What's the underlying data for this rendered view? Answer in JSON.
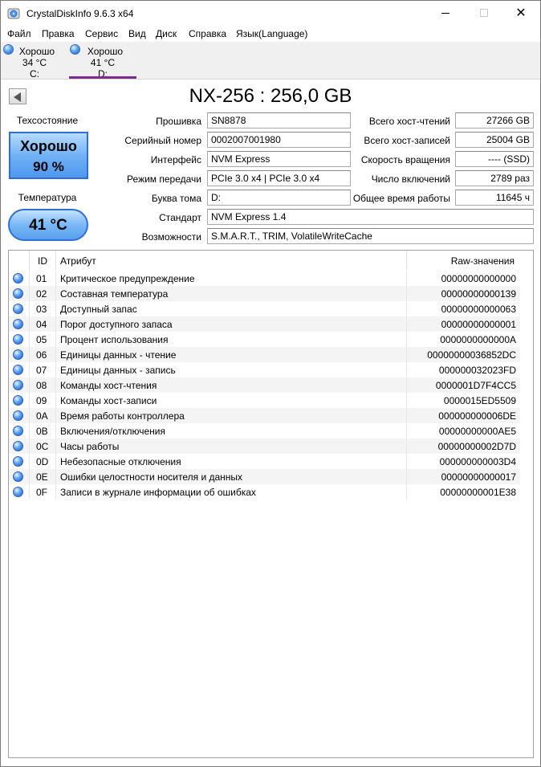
{
  "window": {
    "title": "CrystalDiskInfo 9.6.3 x64",
    "minimize": "–",
    "maximize": "☐",
    "close": "✕"
  },
  "menu": [
    "Файл",
    "Правка",
    "Сервис",
    "Вид",
    "Диск",
    "Справка",
    "Язык(Language)"
  ],
  "disks": [
    {
      "status": "Хорошо",
      "temp": "34 °C",
      "letter": "C:",
      "active": false
    },
    {
      "status": "Хорошо",
      "temp": "41 °C",
      "letter": "D:",
      "active": true
    }
  ],
  "disk": {
    "title": "NX-256 : 256,0 GB",
    "health_label": "Техсостояние",
    "health_status": "Хорошо",
    "health_percent": "90 %",
    "temp_label": "Температура",
    "temperature": "41 °C"
  },
  "info": {
    "firmware_label": "Прошивка",
    "firmware": "SN8878",
    "serial_label": "Серийный номер",
    "serial": "0002007001980",
    "interface_label": "Интерфейс",
    "interface": "NVM Express",
    "transfer_label": "Режим передачи",
    "transfer": "PCIe 3.0 x4 | PCIe 3.0 x4",
    "letter_label": "Буква тома",
    "letter": "D:",
    "standard_label": "Стандарт",
    "standard": "NVM Express 1.4",
    "features_label": "Возможности",
    "features": "S.M.A.R.T., TRIM, VolatileWriteCache",
    "reads_label": "Всего хост-чтений",
    "reads": "27266 GB",
    "writes_label": "Всего хост-записей",
    "writes": "25004 GB",
    "rotation_label": "Скорость вращения",
    "rotation": "---- (SSD)",
    "power_count_label": "Число включений",
    "power_count": "2789 раз",
    "power_hours_label": "Общее время работы",
    "power_hours": "11645 ч"
  },
  "table": {
    "col_id": "ID",
    "col_attr": "Атрибут",
    "col_raw": "Raw-значения",
    "rows": [
      {
        "id": "01",
        "name": "Критическое предупреждение",
        "raw": "00000000000000"
      },
      {
        "id": "02",
        "name": "Составная температура",
        "raw": "00000000000139"
      },
      {
        "id": "03",
        "name": "Доступный запас",
        "raw": "00000000000063"
      },
      {
        "id": "04",
        "name": "Порог доступного запаса",
        "raw": "00000000000001"
      },
      {
        "id": "05",
        "name": "Процент использования",
        "raw": "0000000000000A"
      },
      {
        "id": "06",
        "name": "Единицы данных - чтение",
        "raw": "00000000036852DC"
      },
      {
        "id": "07",
        "name": "Единицы данных - запись",
        "raw": "000000032023FD"
      },
      {
        "id": "08",
        "name": "Команды хост-чтения",
        "raw": "0000001D7F4CC5"
      },
      {
        "id": "09",
        "name": "Команды хост-записи",
        "raw": "0000015ED5509"
      },
      {
        "id": "0A",
        "name": "Время работы контроллера",
        "raw": "000000000006DE"
      },
      {
        "id": "0B",
        "name": "Включения/отключения",
        "raw": "00000000000AE5"
      },
      {
        "id": "0C",
        "name": "Часы работы",
        "raw": "00000000002D7D"
      },
      {
        "id": "0D",
        "name": "Небезопасные отключения",
        "raw": "000000000003D4"
      },
      {
        "id": "0E",
        "name": "Ошибки целостности носителя и данных",
        "raw": "00000000000017"
      },
      {
        "id": "0F",
        "name": "Записи в журнале информации об ошибках",
        "raw": "00000000001E38"
      }
    ]
  }
}
